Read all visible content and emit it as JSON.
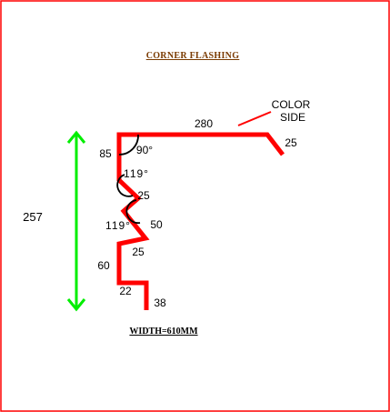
{
  "diagram": {
    "title": "CORNER  FLASHING",
    "width_note": "WIDTH=610MM",
    "color_side_line1": "COLOR",
    "color_side_line2": "SIDE",
    "height_dimension": "257",
    "profile_color": "#ff0000",
    "dimension_color": "#00ff00",
    "frame_color": "#ff0000",
    "title_color": "#7a3a00",
    "segments": {
      "top": "280",
      "top_return": "25",
      "upper_vertical": "85",
      "mid_angle_leg": "25",
      "lower_angle_leg": "50",
      "lower_diagonal": "25",
      "lower_vertical": "60",
      "foot": "22",
      "drop": "38"
    },
    "angles": {
      "corner": "90°",
      "upper_bend": "119°",
      "lower_bend": "119°"
    }
  }
}
